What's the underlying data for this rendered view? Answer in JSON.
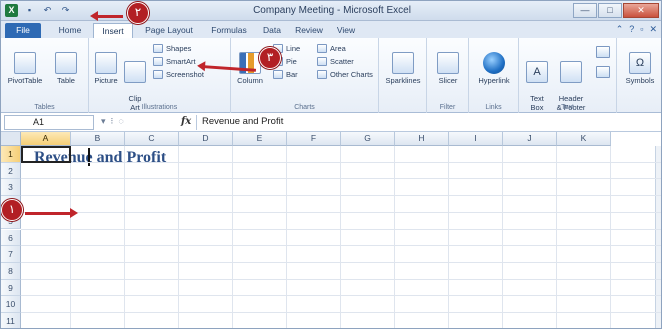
{
  "window": {
    "title": "Company Meeting - Microsoft Excel",
    "minimize": "—",
    "maximize": "□",
    "close": "✕"
  },
  "qat": {
    "excel_icon": "excel-logo-icon",
    "save": "save-icon",
    "undo": "undo-icon",
    "redo": "redo-icon"
  },
  "tabs": [
    {
      "label": "File"
    },
    {
      "label": "Home"
    },
    {
      "label": "Insert"
    },
    {
      "label": "Page Layout"
    },
    {
      "label": "Formulas"
    },
    {
      "label": "Data"
    },
    {
      "label": "Review"
    },
    {
      "label": "View"
    }
  ],
  "ribbon": {
    "tables": {
      "pivottable": "PivotTable",
      "table": "Table",
      "group_label": "Tables"
    },
    "illustrations": {
      "picture": "Picture",
      "clip_art": "Clip\nArt",
      "shapes": "Shapes",
      "smartart": "SmartArt",
      "screenshot": "Screenshot",
      "group_label": "Illustrations"
    },
    "charts": {
      "column": "Column",
      "line": "Line",
      "pie": "Pie",
      "bar": "Bar",
      "area": "Area",
      "scatter": "Scatter",
      "other": "Other Charts",
      "group_label": "Charts"
    },
    "sparklines": {
      "label": "Sparklines"
    },
    "filter": {
      "slicer": "Slicer",
      "group_label": "Filter"
    },
    "links": {
      "hyperlink": "Hyperlink",
      "group_label": "Links"
    },
    "text": {
      "text_box": "Text\nBox",
      "header_footer": "Header\n& Footer",
      "group_label": "Text"
    },
    "symbols": {
      "label": "Symbols"
    }
  },
  "formula_bar": {
    "name_box": "A1",
    "fx": "fx",
    "content": "Revenue and Profit"
  },
  "grid": {
    "columns": [
      "A",
      "B",
      "C",
      "D",
      "E",
      "F",
      "G",
      "H",
      "I",
      "J",
      "K"
    ],
    "rows": [
      "1",
      "2",
      "3",
      "4",
      "5",
      "6",
      "7",
      "8",
      "9",
      "10",
      "11"
    ],
    "a1_value": "Revenue and Profit"
  },
  "callouts": {
    "one": "١",
    "two": "٢",
    "three": "٣"
  },
  "colors": {
    "accent_red": "#b21f24",
    "file_tab": "#2e6ab4",
    "cell_text": "#2d4f86"
  }
}
